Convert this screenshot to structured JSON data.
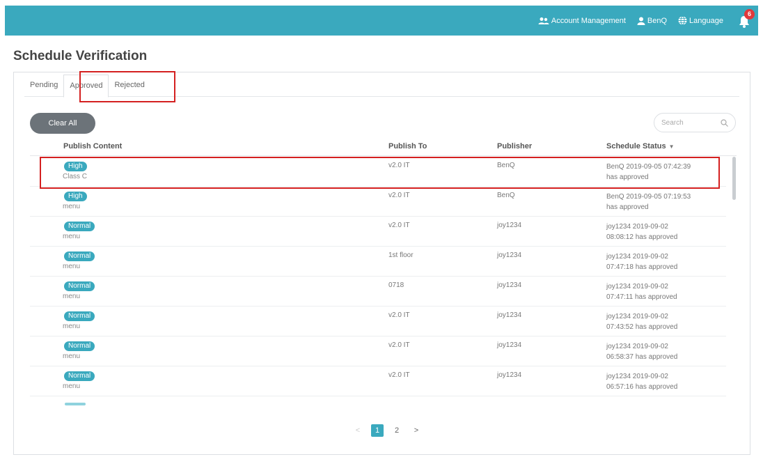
{
  "header": {
    "account_management": "Account Management",
    "user": "BenQ",
    "language": "Language",
    "notification_count": "6"
  },
  "page": {
    "title": "Schedule Verification"
  },
  "tabs": [
    {
      "label": "Pending",
      "active": false
    },
    {
      "label": "Approved",
      "active": true
    },
    {
      "label": "Rejected",
      "active": false
    }
  ],
  "toolbar": {
    "clear_all": "Clear All",
    "search_placeholder": "Search"
  },
  "table": {
    "columns": [
      "Publish Content",
      "Publish To",
      "Publisher",
      "Schedule Status"
    ],
    "rows": [
      {
        "priority": "High",
        "content": "Class C",
        "publish_to": "v2.0 IT",
        "publisher": "BenQ",
        "status_line1": "BenQ 2019-09-05 07:42:39",
        "status_line2": "has approved"
      },
      {
        "priority": "High",
        "content": "menu",
        "publish_to": "v2.0 IT",
        "publisher": "BenQ",
        "status_line1": "BenQ 2019-09-05 07:19:53",
        "status_line2": "has approved"
      },
      {
        "priority": "Normal",
        "content": "menu",
        "publish_to": "v2.0 IT",
        "publisher": "joy1234",
        "status_line1": "joy1234 2019-09-02",
        "status_line2": "08:08:12 has approved"
      },
      {
        "priority": "Normal",
        "content": "menu",
        "publish_to": "1st floor",
        "publisher": "joy1234",
        "status_line1": "joy1234 2019-09-02",
        "status_line2": "07:47:18 has approved"
      },
      {
        "priority": "Normal",
        "content": "menu",
        "publish_to": "0718",
        "publisher": "joy1234",
        "status_line1": "joy1234 2019-09-02",
        "status_line2": "07:47:11 has approved"
      },
      {
        "priority": "Normal",
        "content": "menu",
        "publish_to": "v2.0 IT",
        "publisher": "joy1234",
        "status_line1": "joy1234 2019-09-02",
        "status_line2": "07:43:52 has approved"
      },
      {
        "priority": "Normal",
        "content": "menu",
        "publish_to": "v2.0 IT",
        "publisher": "joy1234",
        "status_line1": "joy1234 2019-09-02",
        "status_line2": "06:58:37 has approved"
      },
      {
        "priority": "Normal",
        "content": "menu",
        "publish_to": "v2.0 IT",
        "publisher": "joy1234",
        "status_line1": "joy1234 2019-09-02",
        "status_line2": "06:57:16 has approved"
      }
    ]
  },
  "pagination": {
    "prev": "<",
    "pages": [
      "1",
      "2"
    ],
    "current": "1",
    "next": ">"
  },
  "colors": {
    "accent": "#3aa9be",
    "highlight": "#d42020",
    "button": "#6c7379",
    "badge": "#e0393b"
  }
}
